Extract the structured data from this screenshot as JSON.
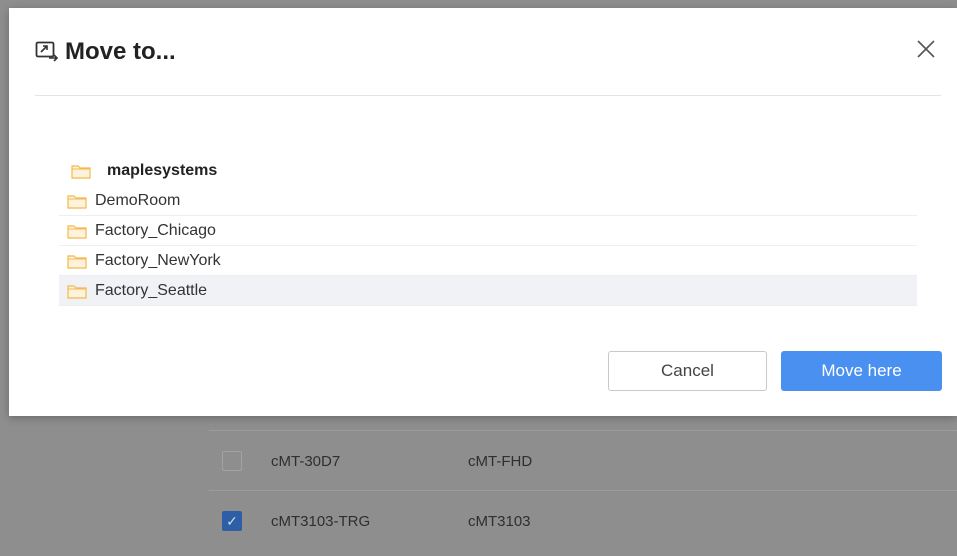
{
  "dialog": {
    "title": "Move to...",
    "title_icon": "move-to-icon",
    "close_icon": "close-icon"
  },
  "tree": {
    "root": {
      "label": "maplesystems",
      "icon": "folder-icon"
    },
    "items": [
      {
        "label": "DemoRoom",
        "icon": "folder-icon",
        "highlighted": false
      },
      {
        "label": "Factory_Chicago",
        "icon": "folder-icon",
        "highlighted": false
      },
      {
        "label": "Factory_NewYork",
        "icon": "folder-icon",
        "highlighted": false
      },
      {
        "label": "Factory_Seattle",
        "icon": "folder-icon",
        "highlighted": true
      }
    ]
  },
  "buttons": {
    "cancel": "Cancel",
    "move": "Move here"
  },
  "background_table": {
    "rows": [
      {
        "checked": false,
        "name": "cMT-30D7",
        "model": "cMT-FHD"
      },
      {
        "checked": true,
        "name": "cMT3103-TRG",
        "model": "cMT3103"
      }
    ]
  },
  "colors": {
    "folder": "#f9c96a",
    "primary": "#4a90f0",
    "overlay": "#8e8e8e"
  }
}
